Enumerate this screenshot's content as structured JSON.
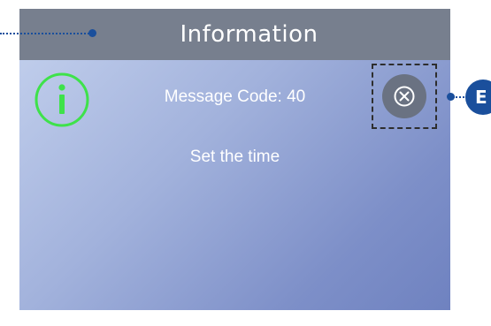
{
  "title_bar": {
    "title": "Information"
  },
  "message": {
    "code_label": "Message Code: 40",
    "text": "Set the time"
  },
  "icons": {
    "info": "info-icon",
    "close": "close-icon"
  },
  "callouts": {
    "right_badge_label": "E"
  },
  "colors": {
    "title_bar": "#777f8e",
    "info_icon": "#3ee24a",
    "close_button": "#6a7282",
    "callout": "#1a4f9c"
  }
}
